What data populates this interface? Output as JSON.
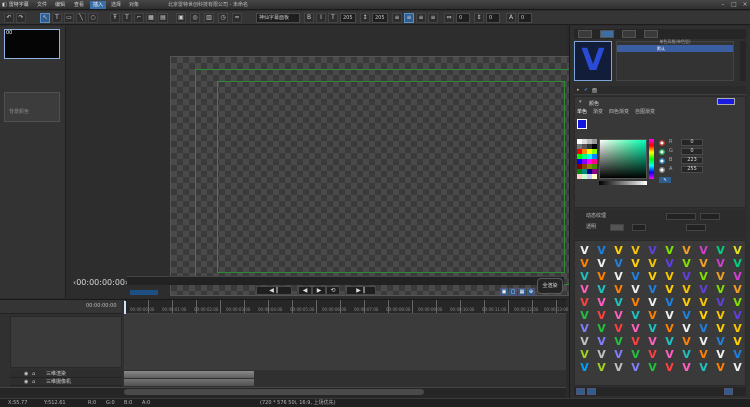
{
  "titlebar": {
    "app_name": "雷特字幕",
    "menus": [
      "文件",
      "编辑",
      "查看",
      "插入",
      "选择",
      "对象"
    ],
    "active_menu_index": 3,
    "doc_title": "北京雷特世创科技有限公司 - 未命名"
  },
  "toolbar": {
    "font_select": "神仙字幕面板",
    "size_a": "205",
    "size_b": "205"
  },
  "left_panel": {
    "thumb1_label": "00",
    "thumb2_label": "背景颜色"
  },
  "preview": {
    "timecode": "00:00:00:00",
    "render_button": "全渲染"
  },
  "timeline": {
    "header_timecode": "00:00:00:00",
    "ruler_labels": [
      "00:00:00:00",
      "00:00:01:00",
      "00:00:02:00",
      "00:00:03:00",
      "00:00:04:00",
      "00:00:05:00",
      "00:00:06:00",
      "00:00:07:00",
      "00:00:08:00",
      "00:00:09:00",
      "00:00:10:00",
      "00:00:11:00",
      "00:00:12:00",
      "00:00:13:00"
    ],
    "tracks": [
      "三维渲染",
      "三维摄像机"
    ]
  },
  "status": {
    "x": "X:55.77",
    "y": "Y:512.61",
    "r": "R:0",
    "g": "G:0",
    "b": "B:0",
    "a": "A:0",
    "format": "(720 * 576 50i, 16:9, 上场优先)"
  },
  "right_panel": {
    "style_preview_glyph": "V",
    "style_header": "单色风格(单色型)",
    "style_row": "默认",
    "section_label": "面",
    "color_title": "颜色",
    "color_tabs": [
      "单色",
      "渐变",
      "四色渐变",
      "自图渐变"
    ],
    "rgba": [
      {
        "label": "R",
        "value": "0"
      },
      {
        "label": "G",
        "value": "0"
      },
      {
        "label": "B",
        "value": "223"
      },
      {
        "label": "A",
        "value": "255"
      }
    ],
    "effect_rows": [
      "动态纹理",
      "透明"
    ],
    "colors": {
      "accent": "#3e6da3",
      "selected_fill": "#1515e0"
    }
  }
}
